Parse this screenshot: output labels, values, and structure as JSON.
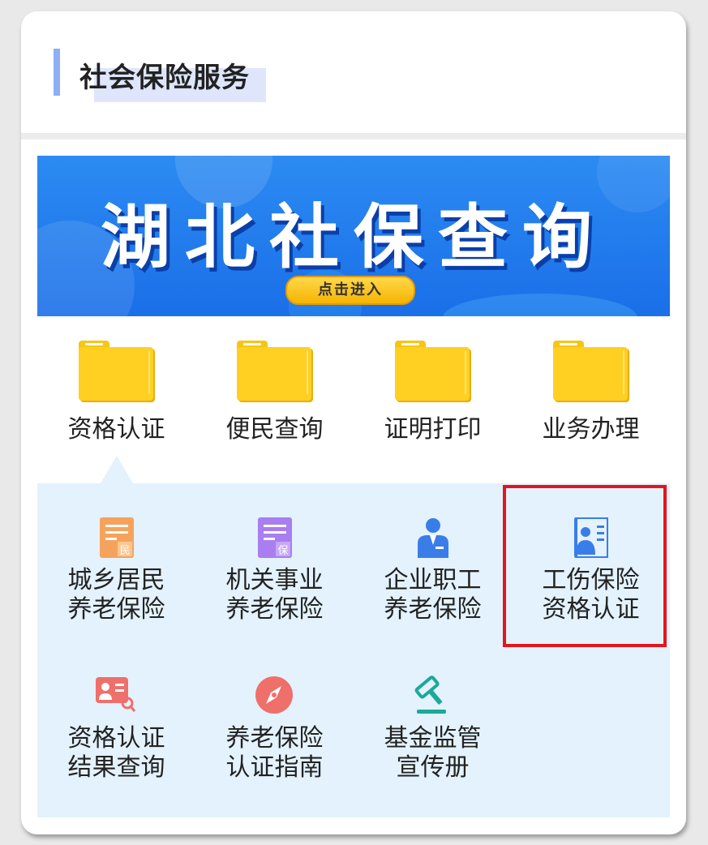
{
  "header": {
    "title": "社会保险服务"
  },
  "banner": {
    "title": "湖北社保查询",
    "button": "点击进入"
  },
  "tabs": [
    {
      "label": "资格认证",
      "icon": "folder-icon"
    },
    {
      "label": "便民查询",
      "icon": "folder-icon"
    },
    {
      "label": "证明打印",
      "icon": "folder-icon"
    },
    {
      "label": "业务办理",
      "icon": "folder-icon"
    }
  ],
  "items": [
    {
      "line1": "城乡居民",
      "line2": "养老保险",
      "icon": "resident-document-icon",
      "color": "#f5a35c"
    },
    {
      "line1": "机关事业",
      "line2": "养老保险",
      "icon": "insurance-document-icon",
      "color": "#a97ef0"
    },
    {
      "line1": "企业职工",
      "line2": "养老保险",
      "icon": "employee-icon",
      "color": "#3b7de8"
    },
    {
      "line1": "工伤保险",
      "line2": "资格认证",
      "icon": "worker-id-card-icon",
      "color": "#3b7de8"
    },
    {
      "line1": "资格认证",
      "line2": "结果查询",
      "icon": "id-card-search-icon",
      "color": "#ef6f6b"
    },
    {
      "line1": "养老保险",
      "line2": "认证指南",
      "icon": "compass-icon",
      "color": "#ef6f6b"
    },
    {
      "line1": "基金监管",
      "line2": "宣传册",
      "icon": "gavel-icon",
      "color": "#1aa99b"
    }
  ],
  "colors": {
    "accent": "#8db0f5",
    "highlight": "#e2161e",
    "panel": "#e3f2fc"
  }
}
